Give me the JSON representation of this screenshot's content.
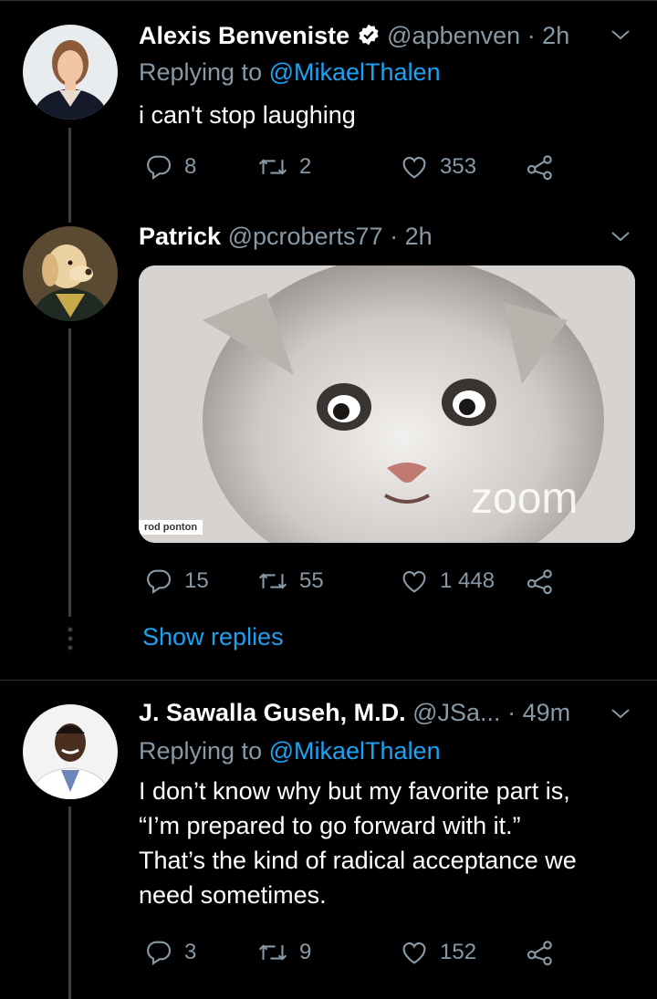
{
  "tweets": [
    {
      "name": "Alexis Benveniste",
      "verified": true,
      "handle": "@apbenven",
      "time": "· 2h",
      "replying_prefix": "Replying to",
      "replying_mention": "@MikaelThalen",
      "text": "i can't stop laughing",
      "replies": "8",
      "retweets": "2",
      "likes": "353"
    },
    {
      "name": "Patrick",
      "handle": "@pcroberts77",
      "time": "· 2h",
      "media": {
        "overlay_name": "rod ponton",
        "watermark": "zoom"
      },
      "replies": "15",
      "retweets": "55",
      "likes": "1 448",
      "show_replies": "Show replies"
    },
    {
      "name": "J. Sawalla Guseh, M.D.",
      "handle": "@JSa...",
      "time": "· 49m",
      "replying_prefix": "Replying to",
      "replying_mention": "@MikaelThalen",
      "text_lines": [
        "I don’t know why but my favorite part is,",
        "“I’m prepared to go forward with it.”",
        "That’s the kind of radical acceptance we",
        "need sometimes."
      ],
      "replies": "3",
      "retweets": "9",
      "likes": "152"
    }
  ],
  "colors": {
    "background": "#000000",
    "secondary": "#8899a6",
    "link": "#1da1f2"
  },
  "icons": [
    "reply-icon",
    "retweet-icon",
    "like-icon",
    "share-icon",
    "chevron-down-icon",
    "verified-badge-icon"
  ]
}
